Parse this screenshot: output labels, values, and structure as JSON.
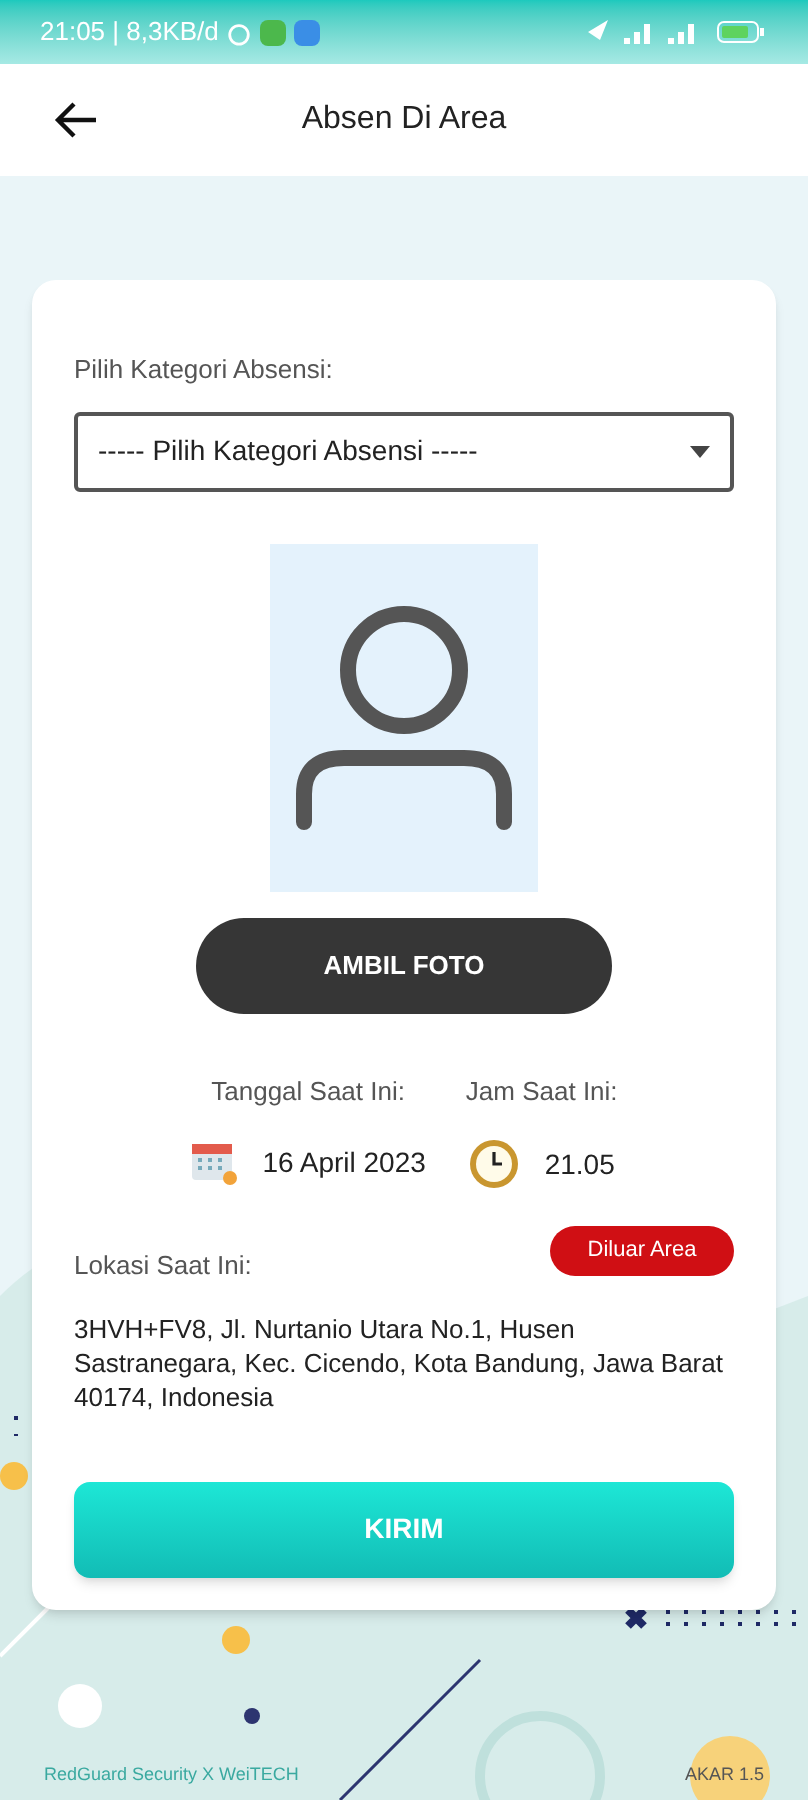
{
  "status_bar": {
    "time": "21:05 | 8,3KB/d"
  },
  "app_bar": {
    "title": "Absen Di Area"
  },
  "form": {
    "category_label": "Pilih Kategori Absensi:",
    "category_dropdown": {
      "value": "----- Pilih Kategori Absensi -----"
    },
    "photo_button": "AMBIL FOTO",
    "date_label": "Tanggal Saat Ini:",
    "date_value": "16 April 2023",
    "time_label": "Jam Saat Ini:",
    "time_value": "21.05",
    "location_label": "Lokasi Saat Ini:",
    "location_badge": "Diluar Area",
    "address": "3HVH+FV8, Jl. Nurtanio Utara No.1, Husen Sastranegara, Kec. Cicendo, Kota Bandung, Jawa Barat 40174, Indonesia",
    "submit_button": "KIRIM"
  },
  "footer": {
    "credit": "RedGuard Security X WeiTECH",
    "version": "AKAR 1.5"
  }
}
